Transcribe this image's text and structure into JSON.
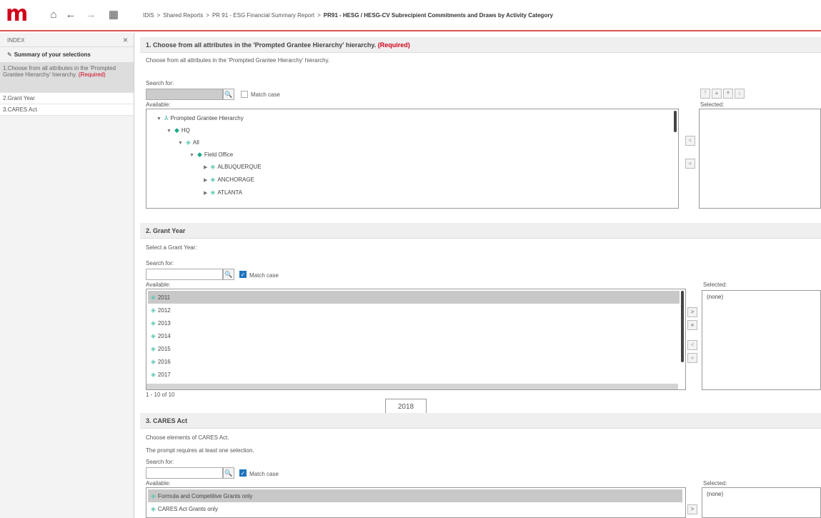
{
  "topbar": {
    "logo": "m",
    "breadcrumb": [
      "IDIS",
      "Shared Reports",
      "PR 91 - ESG Financial Summary Report"
    ],
    "breadcrumb_last": "PR91 - HESG / HESG-CV Subrecipient Commitments and Draws by Activity Category"
  },
  "sidebar": {
    "title": "INDEX",
    "summary": "Summary of your selections",
    "items": [
      {
        "label": "1.Choose from all attributes in the 'Prompted Grantee Hierarchy' hierarchy.",
        "required": "(Required)"
      },
      {
        "label": "2.Grant Year"
      },
      {
        "label": "3.CARES Act"
      }
    ]
  },
  "section1": {
    "header": "1. Choose from all attributes in the 'Prompted Grantee Hierarchy' hierarchy.",
    "required": "(Required)",
    "description": "Choose from all attributes in the 'Prompted Grantee Hierarchy' hierarchy.",
    "search_label": "Search for:",
    "match_case": "Match case",
    "available_label": "Available:",
    "selected_label": "Selected:",
    "tree": [
      "Prompted Grantee Hierarchy",
      "HQ",
      "All",
      "Field Office",
      "ALBUQUERQUE",
      "ANCHORAGE",
      "ATLANTA"
    ]
  },
  "section2": {
    "header": "2. Grant Year",
    "description": "Select a Grant Year:",
    "search_label": "Search for:",
    "match_case": "Match case",
    "available_label": "Available:",
    "selected_label": "Selected:",
    "years": [
      "2011",
      "2012",
      "2013",
      "2014",
      "2015",
      "2016",
      "2017"
    ],
    "pager": "1 - 10 of 10",
    "selected_value": "(none)",
    "tooltip": "2018"
  },
  "section3": {
    "header": "3. CARES Act",
    "description": "Choose elements of CARES Act.",
    "note": "The prompt requires at least one selection.",
    "search_label": "Search for:",
    "match_case": "Match case",
    "available_label": "Available:",
    "selected_label": "Selected:",
    "options": [
      "Formula and Competitive Grants only",
      "CARES Act Grants only"
    ],
    "selected_value": "(none)"
  }
}
